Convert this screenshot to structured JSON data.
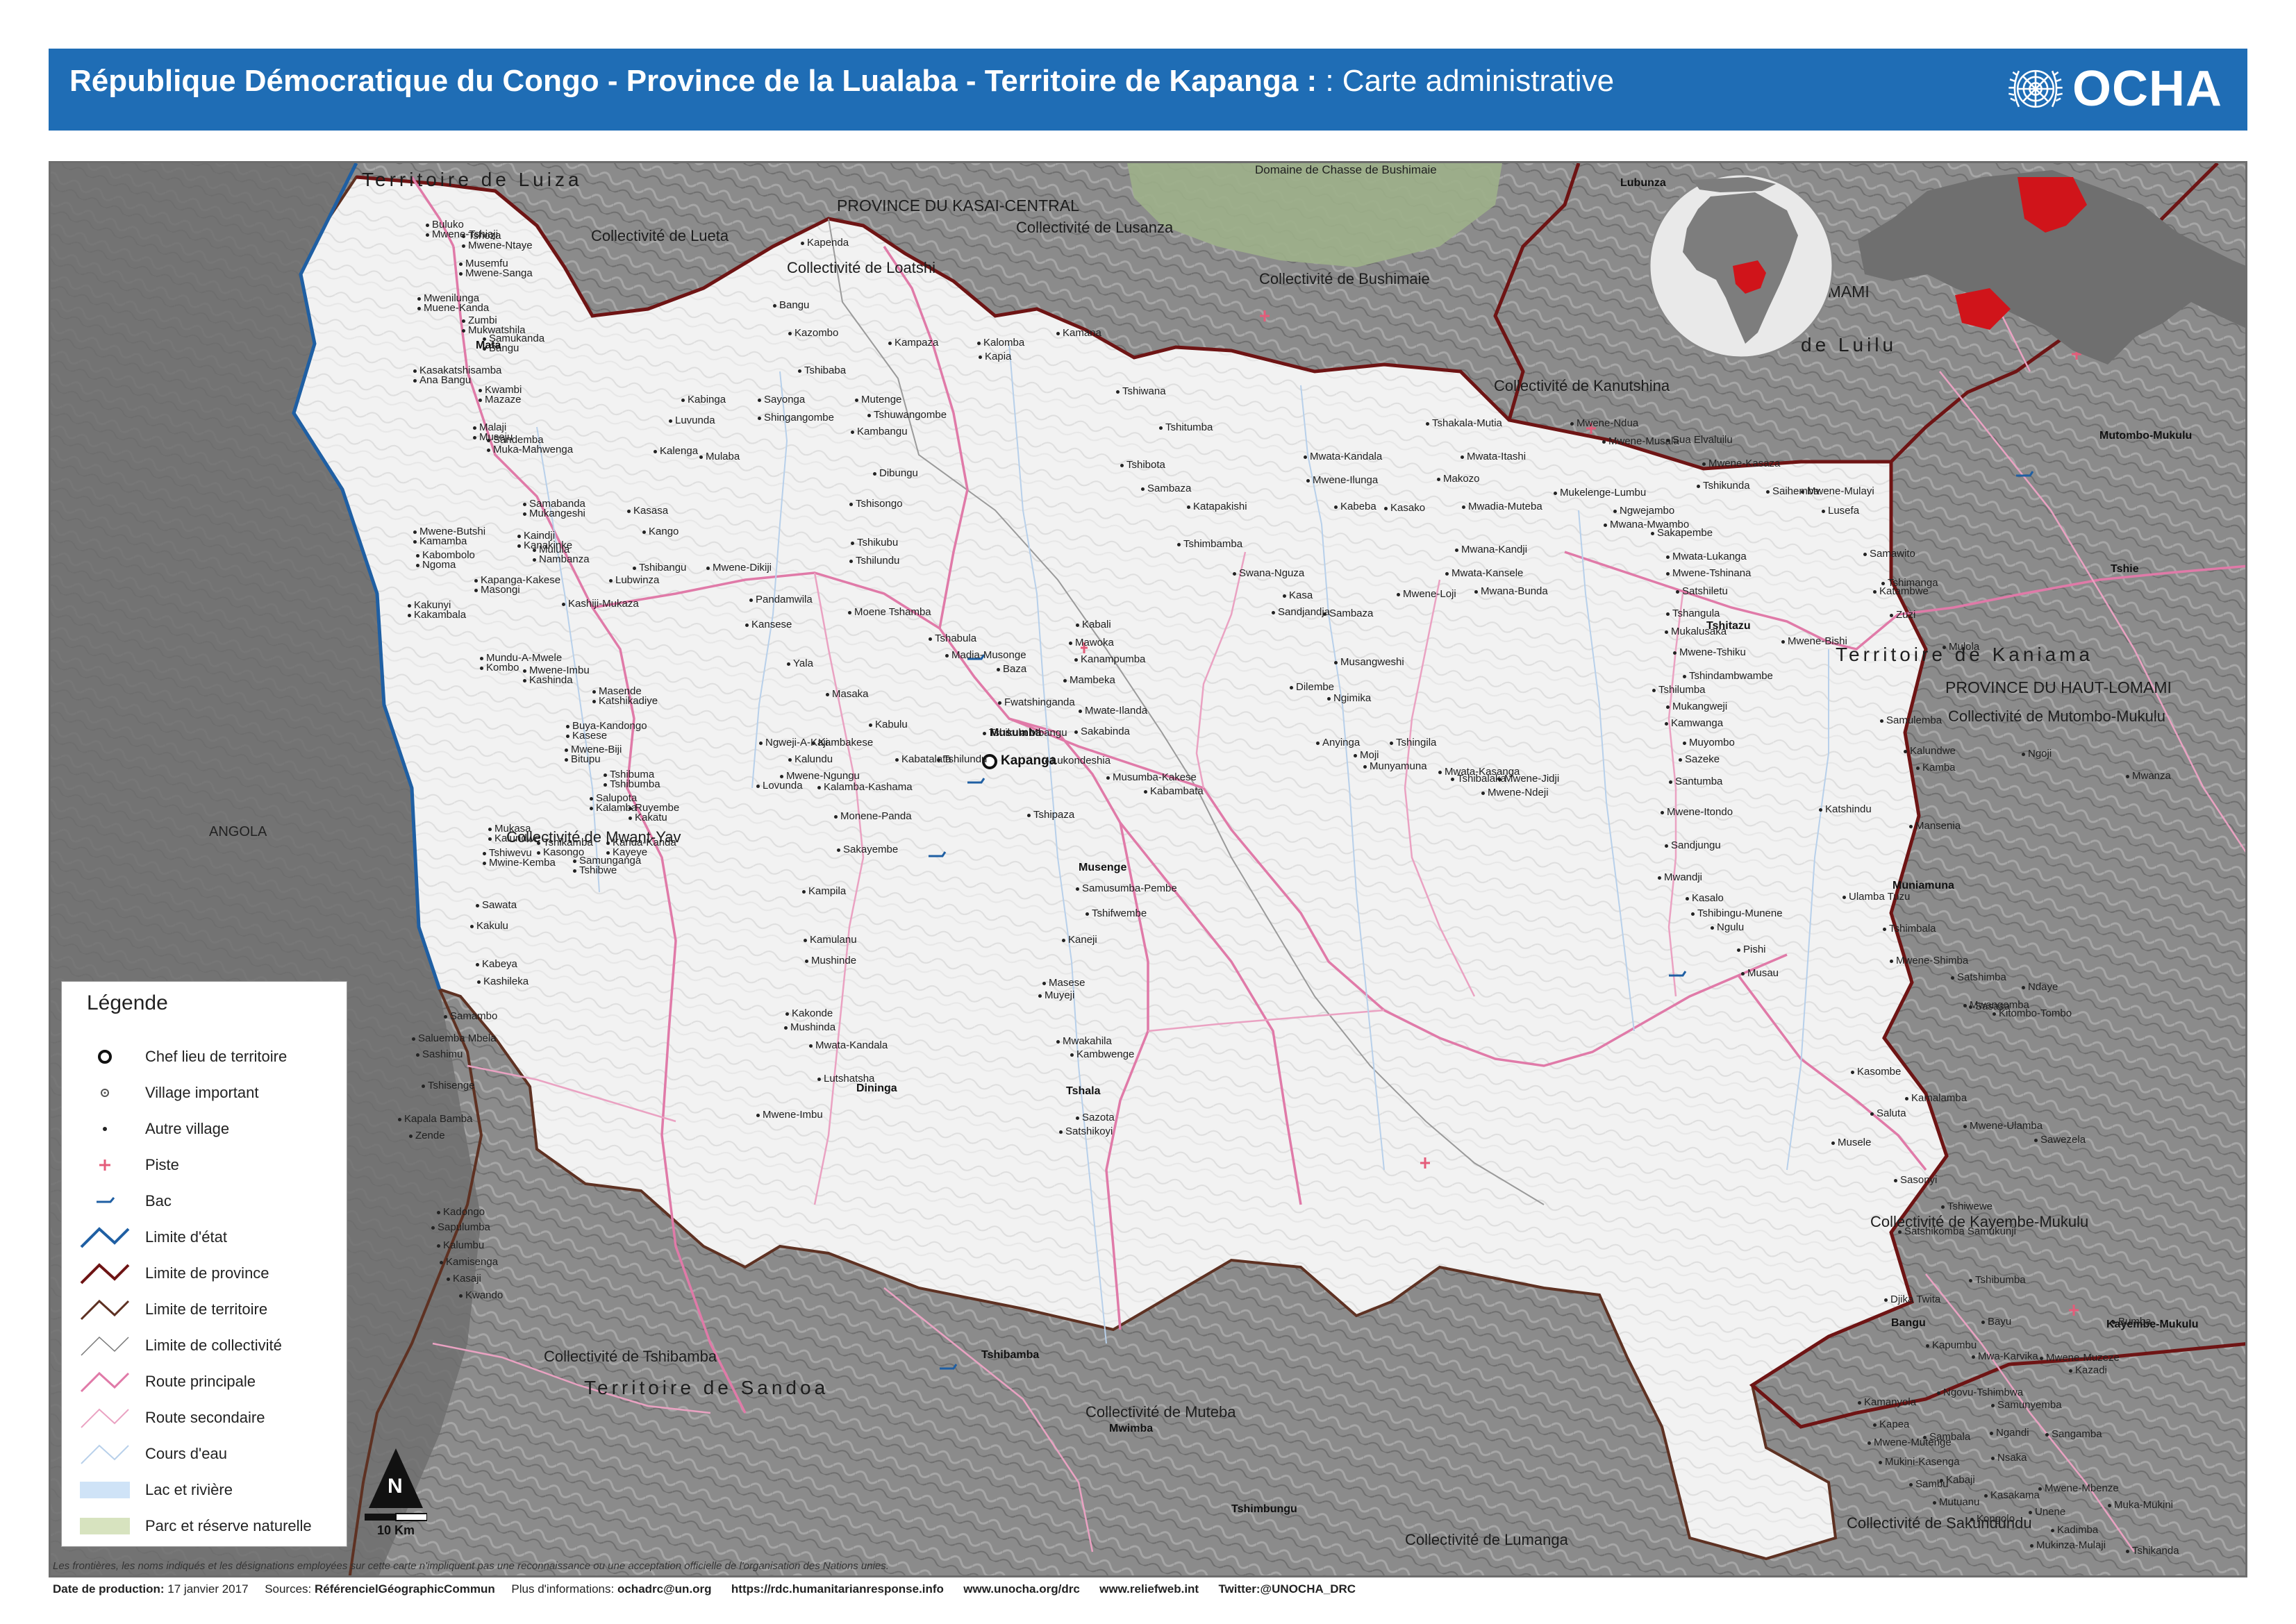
{
  "header": {
    "title_main": "République Démocratique du Congo - Province de la Lualaba - Territoire de Kapanga : ",
    "title_sub": ": Carte administrative",
    "logo_text": "OCHA"
  },
  "colors": {
    "banner": "#1f6db5",
    "state_border": "#1f5fa3",
    "province_border": "#6e1414",
    "territory_border": "#5e3122",
    "main_road": "#e07aa8",
    "secondary_road": "#eaa2c2",
    "inset_highlight": "#d0141a"
  },
  "map": {
    "country_labels": [
      {
        "text": "ANGOLA"
      }
    ],
    "province_labels": [
      {
        "text": "PROVINCE DU KASAI-CENTRAL"
      },
      {
        "text": "PROVINCE DU HAUT-LOMAMI"
      }
    ],
    "territory_labels": [
      {
        "text": "Territoire de Luiza"
      },
      {
        "text": "Territoire de Kaniama"
      },
      {
        "text": "Territoire de Sandoa"
      },
      {
        "text": "de Luilu"
      },
      {
        "text": "LOMAMI"
      }
    ],
    "collectivite_labels": [
      {
        "text": "Collectivité de Lueta"
      },
      {
        "text": "Collectivité de Lusanza"
      },
      {
        "text": "Collectivité de Loatshi"
      },
      {
        "text": "Collectivité de Bushimaie"
      },
      {
        "text": "Collectivité de Kanutshina"
      },
      {
        "text": "Collectivité de Mwant-Yav"
      },
      {
        "text": "Collectivité de Mutombo-Mukulu"
      },
      {
        "text": "Collectivité de Kayembe-Mukulu"
      },
      {
        "text": "Collectivité de Tshibamba"
      },
      {
        "text": "Collectivité de Muteba"
      },
      {
        "text": "Collectivité de Lumanga"
      },
      {
        "text": "Collectivité de Sakundundu"
      },
      {
        "text": "Domaine de Chasse de Bushimaie"
      }
    ],
    "towns_important": [
      {
        "text": "Kapanga"
      },
      {
        "text": "Musumba"
      },
      {
        "text": "Musenge"
      },
      {
        "text": "Dininga"
      },
      {
        "text": "Tshala"
      },
      {
        "text": "Mata"
      },
      {
        "text": "Tshitazu"
      },
      {
        "text": "Lubunza"
      },
      {
        "text": "Tshie"
      },
      {
        "text": "Muniamuna"
      },
      {
        "text": "Bangu"
      },
      {
        "text": "Mwimba"
      },
      {
        "text": "Tshimbungu"
      },
      {
        "text": "Tshibamba"
      },
      {
        "text": "Mutombo-Mukulu"
      },
      {
        "text": "Kayembe-Mukulu"
      }
    ],
    "villages": [
      {
        "text": "Buluko"
      },
      {
        "text": "Tshoza"
      },
      {
        "text": "Musemfu"
      },
      {
        "text": "Mwenilunga"
      },
      {
        "text": "Zumbi"
      },
      {
        "text": "Samukanda"
      },
      {
        "text": "Kasakatshisamba"
      },
      {
        "text": "Kwambi"
      },
      {
        "text": "Malaji"
      },
      {
        "text": "Sandemba"
      },
      {
        "text": "Samabanda"
      },
      {
        "text": "Mwene-Butshi"
      },
      {
        "text": "Kaindji"
      },
      {
        "text": "Mulula"
      },
      {
        "text": "Kabombolo"
      },
      {
        "text": "Kapanga-Kakese"
      },
      {
        "text": "Kakunyi"
      },
      {
        "text": "Mundu-A-Mwele"
      },
      {
        "text": "Mwene-Imbu"
      },
      {
        "text": "Masende"
      },
      {
        "text": "Buya-Kandongo"
      },
      {
        "text": "Mwene-Biji"
      },
      {
        "text": "Tshibuma"
      },
      {
        "text": "Salupota"
      },
      {
        "text": "Ruyembe"
      },
      {
        "text": "Mukasa"
      },
      {
        "text": "Tshikamba"
      },
      {
        "text": "Kanda-Kanda"
      },
      {
        "text": "Tshiwevu"
      },
      {
        "text": "Samunganga"
      },
      {
        "text": "Sawata"
      },
      {
        "text": "Kakulu"
      },
      {
        "text": "Kabeya"
      },
      {
        "text": "Kashileka"
      },
      {
        "text": "Samambo"
      },
      {
        "text": "Saluemba Mbela"
      },
      {
        "text": "Sashimu"
      },
      {
        "text": "Tshisenge"
      },
      {
        "text": "Kapala Bamba"
      },
      {
        "text": "Zende"
      },
      {
        "text": "Kadongo"
      },
      {
        "text": "Sapulumba"
      },
      {
        "text": "Kalumbu"
      },
      {
        "text": "Kamisenga"
      },
      {
        "text": "Kasaji"
      },
      {
        "text": "Kwando"
      },
      {
        "text": "Kapenda"
      },
      {
        "text": "Bangu"
      },
      {
        "text": "Kazombo"
      },
      {
        "text": "Kampaza"
      },
      {
        "text": "Kalomba"
      },
      {
        "text": "Kapia"
      },
      {
        "text": "Kamana"
      },
      {
        "text": "Tshibaba"
      },
      {
        "text": "Kabinga"
      },
      {
        "text": "Sayonga"
      },
      {
        "text": "Mutenge"
      },
      {
        "text": "Shingangombe"
      },
      {
        "text": "Tshuwangombe"
      },
      {
        "text": "Luvunda"
      },
      {
        "text": "Kambangu"
      },
      {
        "text": "Kalenga"
      },
      {
        "text": "Mulaba"
      },
      {
        "text": "Dibungu"
      },
      {
        "text": "Tshisongo"
      },
      {
        "text": "Kasasa"
      },
      {
        "text": "Kango"
      },
      {
        "text": "Tshikubu"
      },
      {
        "text": "Tshilundu"
      },
      {
        "text": "Tshibangu"
      },
      {
        "text": "Lubwinza"
      },
      {
        "text": "Mwene-Dikiji"
      },
      {
        "text": "Pandamwila"
      },
      {
        "text": "Kashiji-Mukaza"
      },
      {
        "text": "Kansese"
      },
      {
        "text": "Moene Tshamba"
      },
      {
        "text": "Tshabula"
      },
      {
        "text": "Kabali"
      },
      {
        "text": "Mawoka"
      },
      {
        "text": "Kanampumba"
      },
      {
        "text": "Madia-Musonge"
      },
      {
        "text": "Baza"
      },
      {
        "text": "Yala"
      },
      {
        "text": "Mambeka"
      },
      {
        "text": "Masaka"
      },
      {
        "text": "Fwatshinganda"
      },
      {
        "text": "Mwate-Ilanda"
      },
      {
        "text": "Kabulu"
      },
      {
        "text": "Tshikula Mbangu"
      },
      {
        "text": "Sakabinda"
      },
      {
        "text": "Ngweji-A-Kaji"
      },
      {
        "text": "Kambakese"
      },
      {
        "text": "Kalundu"
      },
      {
        "text": "Kabatalata"
      },
      {
        "text": "Tshilundu"
      },
      {
        "text": "Lukondeshia"
      },
      {
        "text": "Mwene-Ngungu"
      },
      {
        "text": "Musumba-Kakese"
      },
      {
        "text": "Lovunda"
      },
      {
        "text": "Kalamba-Kashama"
      },
      {
        "text": "Kabambata"
      },
      {
        "text": "Monene-Panda"
      },
      {
        "text": "Tshipaza"
      },
      {
        "text": "Sakayembe"
      },
      {
        "text": "Samusumba-Pembe"
      },
      {
        "text": "Kampila"
      },
      {
        "text": "Tshifwembe"
      },
      {
        "text": "Kamulanu"
      },
      {
        "text": "Kaneji"
      },
      {
        "text": "Mushinde"
      },
      {
        "text": "Masese"
      },
      {
        "text": "Muyeji"
      },
      {
        "text": "Kakonde"
      },
      {
        "text": "Mushinda"
      },
      {
        "text": "Mwata-Kandala"
      },
      {
        "text": "Mwakahila"
      },
      {
        "text": "Kambwenge"
      },
      {
        "text": "Lutshatsha"
      },
      {
        "text": "Mwene-Imbu"
      },
      {
        "text": "Sazota"
      },
      {
        "text": "Satshikoyi"
      },
      {
        "text": "Tshiwana"
      },
      {
        "text": "Tshitumba"
      },
      {
        "text": "Tshibota"
      },
      {
        "text": "Sambaza"
      },
      {
        "text": "Katapakishi"
      },
      {
        "text": "Tshimbamba"
      },
      {
        "text": "Swana-Nguza"
      },
      {
        "text": "Kasa"
      },
      {
        "text": "Sandjandja"
      },
      {
        "text": "Sambaza"
      },
      {
        "text": "Musangweshi"
      },
      {
        "text": "Dilembe"
      },
      {
        "text": "Ngimika"
      },
      {
        "text": "Anyinga"
      },
      {
        "text": "Tshingila"
      },
      {
        "text": "Moji"
      },
      {
        "text": "Munyamuna"
      },
      {
        "text": "Mwata-Kasanga"
      },
      {
        "text": "Tshibalaka"
      },
      {
        "text": "Mwene-Jidji"
      },
      {
        "text": "Mwene-Ndeji"
      },
      {
        "text": "Tshakala-Mutia"
      },
      {
        "text": "Mwata-Kandala"
      },
      {
        "text": "Mwata-Itashi"
      },
      {
        "text": "Mwene-Ilunga"
      },
      {
        "text": "Makozo"
      },
      {
        "text": "Kabeba"
      },
      {
        "text": "Kasako"
      },
      {
        "text": "Mwadia-Muteba"
      },
      {
        "text": "Mwana-Kandji"
      },
      {
        "text": "Mwata-Kansele"
      },
      {
        "text": "Mwana-Bunda"
      },
      {
        "text": "Mwene-Loji"
      },
      {
        "text": "Mwene-Ndua"
      },
      {
        "text": "Mwene-Musala"
      },
      {
        "text": "Mukelenge-Lumbu"
      },
      {
        "text": "Ngwejambo"
      },
      {
        "text": "Mwana-Mwambo"
      },
      {
        "text": "Sakapembe"
      },
      {
        "text": "Mwata-Lukanga"
      },
      {
        "text": "Mwene-Tshinana"
      },
      {
        "text": "Satshiletu"
      },
      {
        "text": "Tshangula"
      },
      {
        "text": "Mukalusaka"
      },
      {
        "text": "Mwene-Tshiku"
      },
      {
        "text": "Tshindambwambe"
      },
      {
        "text": "Tshilumba"
      },
      {
        "text": "Mukangweji"
      },
      {
        "text": "Kamwanga"
      },
      {
        "text": "Muyombo"
      },
      {
        "text": "Sazeke"
      },
      {
        "text": "Santumba"
      },
      {
        "text": "Mwene-Itondo"
      },
      {
        "text": "Sandjungu"
      },
      {
        "text": "Mwandji"
      },
      {
        "text": "Kasalo"
      },
      {
        "text": "Tshibingu-Munene"
      },
      {
        "text": "Ngulu"
      },
      {
        "text": "Pishi"
      },
      {
        "text": "Musau"
      },
      {
        "text": "Sua Elvaluilu"
      },
      {
        "text": "Mwene-Kasaza"
      },
      {
        "text": "Tshikunda"
      },
      {
        "text": "Saihemba"
      },
      {
        "text": "Mwene-Mulayi"
      },
      {
        "text": "Lusefa"
      },
      {
        "text": "Samawito"
      },
      {
        "text": "Tshimanga"
      },
      {
        "text": "Katambwe"
      },
      {
        "text": "Zuzi"
      },
      {
        "text": "Mwene-Bishi"
      },
      {
        "text": "Mulola"
      },
      {
        "text": "Samulemba"
      },
      {
        "text": "Kalundwe"
      },
      {
        "text": "Ngoji"
      },
      {
        "text": "Kamba"
      },
      {
        "text": "Mwanza"
      },
      {
        "text": "Katshindu"
      },
      {
        "text": "Mansenia"
      },
      {
        "text": "Ulamba Tuzu"
      },
      {
        "text": "Tshimbala"
      },
      {
        "text": "Mwene-Shimba"
      },
      {
        "text": "Satshimba"
      },
      {
        "text": "Ndaye"
      },
      {
        "text": "Mwangomba"
      },
      {
        "text": "Kitombo-Tombo"
      },
      {
        "text": "Sasasa"
      },
      {
        "text": "Kasombe"
      },
      {
        "text": "Kamalamba"
      },
      {
        "text": "Saluta"
      },
      {
        "text": "Mwene-Ulamba"
      },
      {
        "text": "Sawezela"
      },
      {
        "text": "Musele"
      },
      {
        "text": "Sasonyi"
      },
      {
        "text": "Tshiwewe"
      },
      {
        "text": "Satshikomba Samukunji"
      },
      {
        "text": "Tshibumba"
      },
      {
        "text": "Djika Twita"
      },
      {
        "text": "Bayu"
      },
      {
        "text": "Bumba"
      },
      {
        "text": "Kapumbu"
      },
      {
        "text": "Mwa-Karvika"
      },
      {
        "text": "Mwene-Muzeze"
      },
      {
        "text": "Kazadi"
      },
      {
        "text": "Kamanyola"
      },
      {
        "text": "Ngovu-Tshimbwa"
      },
      {
        "text": "Samunyemba"
      },
      {
        "text": "Kapea"
      },
      {
        "text": "Sambala"
      },
      {
        "text": "Ngandi"
      },
      {
        "text": "Sangamba"
      },
      {
        "text": "Kabaji"
      },
      {
        "text": "Kasakama"
      },
      {
        "text": "Unene"
      },
      {
        "text": "Kadimba"
      },
      {
        "text": "Mukinza-Mulaji"
      },
      {
        "text": "Mwene-Mutenge"
      },
      {
        "text": "Tshikanda"
      },
      {
        "text": "Nsaka"
      },
      {
        "text": "Mukini-Kasenga"
      },
      {
        "text": "Sambu"
      },
      {
        "text": "Mutuanu"
      },
      {
        "text": "Kongolo"
      },
      {
        "text": "Mwene-Mbenze"
      },
      {
        "text": "Muka-Mukini"
      },
      {
        "text": "Mwene-Tshiaji"
      },
      {
        "text": "Mwene-Ntaye"
      },
      {
        "text": "Mwene-Sanga"
      },
      {
        "text": "Muene-Kanda"
      },
      {
        "text": "Mukwatshila"
      },
      {
        "text": "Bangu"
      },
      {
        "text": "Ana Bangu"
      },
      {
        "text": "Mazaze"
      },
      {
        "text": "Museju"
      },
      {
        "text": "Muka-Mahwenga"
      },
      {
        "text": "Mukangeshi"
      },
      {
        "text": "Kamamba"
      },
      {
        "text": "Kanakinke"
      },
      {
        "text": "Nambanza"
      },
      {
        "text": "Ngoma"
      },
      {
        "text": "Masongi"
      },
      {
        "text": "Kakambala"
      },
      {
        "text": "Kombo"
      },
      {
        "text": "Kashinda"
      },
      {
        "text": "Katshikadiye"
      },
      {
        "text": "Kasese"
      },
      {
        "text": "Bitupu"
      },
      {
        "text": "Tshibumba"
      },
      {
        "text": "Kalamba"
      },
      {
        "text": "Kakatu"
      },
      {
        "text": "Kalundwe"
      },
      {
        "text": "Kasongo"
      },
      {
        "text": "Kayeye"
      },
      {
        "text": "Mwine-Kemba"
      },
      {
        "text": "Tshibwe"
      }
    ]
  },
  "legend": {
    "title": "Légende",
    "items": [
      {
        "label": "Chef lieu de territoire",
        "icon": "territory-capital-icon"
      },
      {
        "label": "Village important",
        "icon": "important-village-icon"
      },
      {
        "label": "Autre village",
        "icon": "other-village-icon"
      },
      {
        "label": "Piste",
        "icon": "airstrip-icon"
      },
      {
        "label": "Bac",
        "icon": "ferry-icon"
      },
      {
        "label": "Limite d'état",
        "icon": "state-boundary-icon"
      },
      {
        "label": "Limite de province",
        "icon": "province-boundary-icon"
      },
      {
        "label": "Limite de territoire",
        "icon": "territory-boundary-icon"
      },
      {
        "label": "Limite de collectivité",
        "icon": "collectivite-boundary-icon"
      },
      {
        "label": "Route principale",
        "icon": "main-road-icon"
      },
      {
        "label": "Route secondaire",
        "icon": "secondary-road-icon"
      },
      {
        "label": "Cours d'eau",
        "icon": "river-icon"
      },
      {
        "label": "Lac et rivière",
        "icon": "lake-icon"
      },
      {
        "label": "Parc et réserve naturelle",
        "icon": "park-icon"
      }
    ]
  },
  "scale": {
    "north_label": "N",
    "distance_label": "10 Km"
  },
  "disclaimer": "Les frontières, les noms indiqués et les désignations employées sur cette carte n'impliquent pas une reconnaissance ou une acceptation officielle de l'organisation des Nations unies.",
  "footer": {
    "production_label": "Date de production:",
    "production_date": "17 janvier 2017",
    "sources_label": "Sources:",
    "sources_value": "RéférencielGéographicCommun",
    "info_label": "Plus d'informations:",
    "email": "ochadrc@un.org",
    "link1": "https://rdc.humanitarianresponse.info",
    "link2": "www.unocha.org/drc",
    "link3": "www.reliefweb.int",
    "twitter": "Twitter:@UNOCHA_DRC"
  }
}
